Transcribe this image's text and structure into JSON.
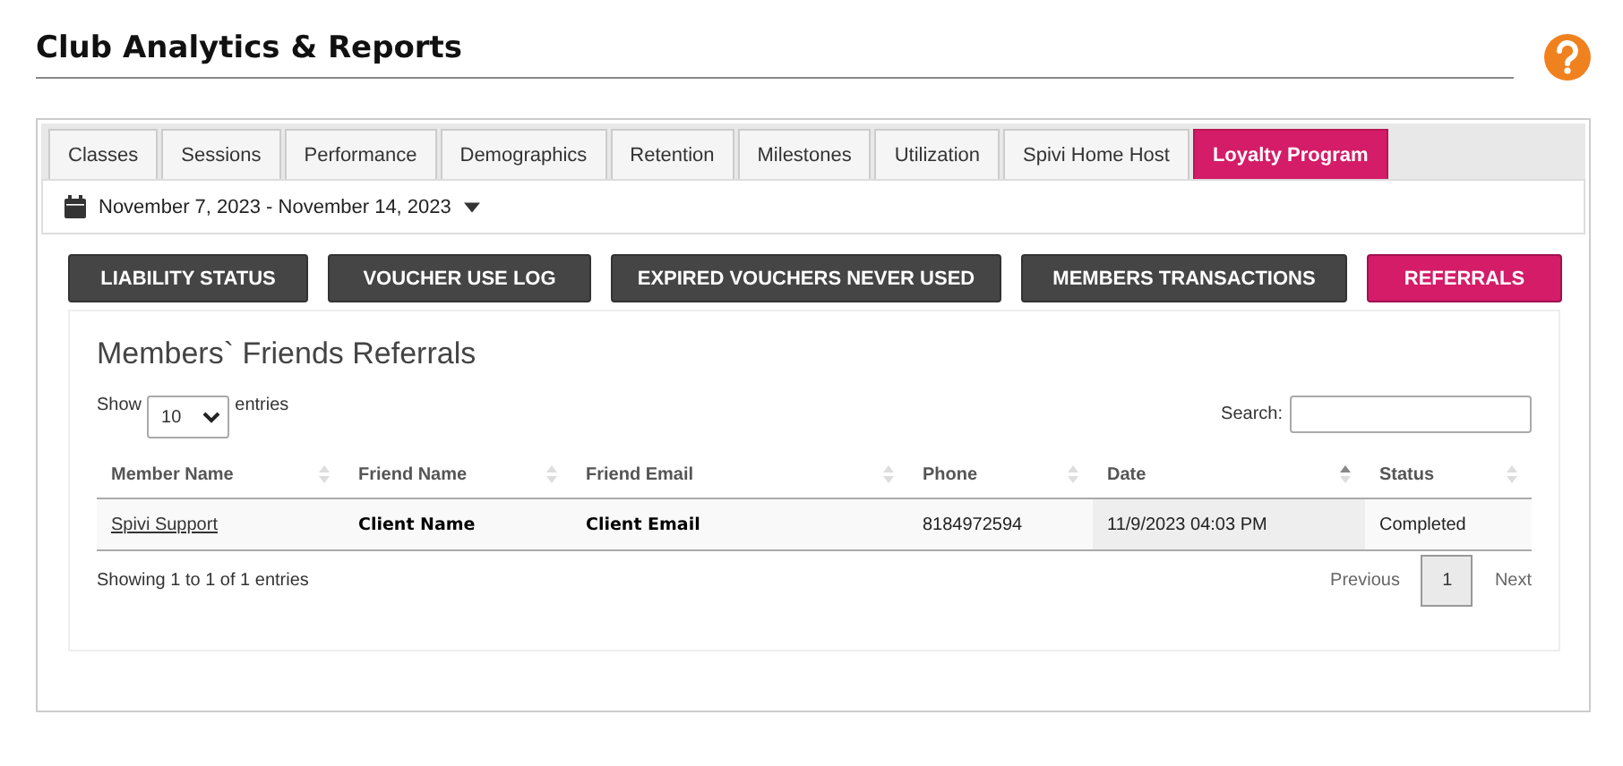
{
  "page_title": "Club Analytics & Reports",
  "tabs": [
    {
      "label": "Classes",
      "selected": false
    },
    {
      "label": "Sessions",
      "selected": false
    },
    {
      "label": "Performance",
      "selected": false
    },
    {
      "label": "Demographics",
      "selected": false
    },
    {
      "label": "Retention",
      "selected": false
    },
    {
      "label": "Milestones",
      "selected": false
    },
    {
      "label": "Utilization",
      "selected": false
    },
    {
      "label": "Spivi Home Host",
      "selected": false
    },
    {
      "label": "Loyalty Program",
      "selected": true
    }
  ],
  "date_range": "November 7, 2023 - November 14, 2023",
  "report_buttons": [
    {
      "label": "LIABILITY STATUS",
      "selected": false
    },
    {
      "label": "VOUCHER USE LOG",
      "selected": false
    },
    {
      "label": "EXPIRED VOUCHERS NEVER USED",
      "selected": false
    },
    {
      "label": "MEMBERS TRANSACTIONS",
      "selected": false
    },
    {
      "label": "REFERRALS",
      "selected": true
    }
  ],
  "section_title": "Members` Friends Referrals",
  "length_label_before": "Show",
  "length_value": "10",
  "length_label_after": "entries",
  "search_label": "Search:",
  "table": {
    "columns": [
      {
        "label": "Member Name",
        "sorted": false
      },
      {
        "label": "Friend Name",
        "sorted": false
      },
      {
        "label": "Friend Email",
        "sorted": false
      },
      {
        "label": "Phone",
        "sorted": false
      },
      {
        "label": "Date",
        "sorted": true
      },
      {
        "label": "Status",
        "sorted": false
      }
    ],
    "rows": [
      {
        "cells": [
          {
            "text": "Spivi Support",
            "kind": "link"
          },
          {
            "text": "Client Name",
            "kind": "bold"
          },
          {
            "text": "Client Email",
            "kind": "bold"
          },
          {
            "text": "8184972594",
            "kind": "plain"
          },
          {
            "text": "11/9/2023 04:03 PM",
            "kind": "plain"
          },
          {
            "text": "Completed",
            "kind": "plain"
          }
        ]
      }
    ]
  },
  "info": "Showing 1 to 1 of 1 entries",
  "pagination": {
    "previous": "Previous",
    "pages": [
      {
        "label": "1",
        "selected": true
      }
    ],
    "next": "Next"
  }
}
